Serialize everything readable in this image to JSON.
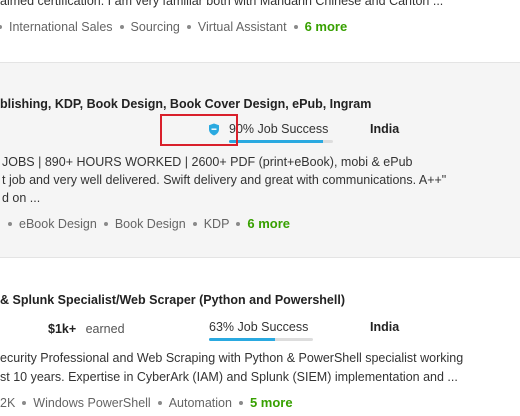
{
  "row1": {
    "cut_text": "aimed certification. I am very familiar both with Mandarin Chinese and Canton ...",
    "skills": [
      "International Sales",
      "Sourcing",
      "Virtual Assistant"
    ],
    "more": "6 more"
  },
  "row2": {
    "title": "blishing, KDP, Book Design, Book Cover Design, ePub, Ingram",
    "job_success": "90% Job Success",
    "job_success_value": 90,
    "country": "India",
    "desc_line1": "JOBS | 890+ HOURS WORKED | 2600+ PDF (print+eBook), mobi & ePub",
    "desc_line2": "t job and very well delivered. Swift delivery and great with communications. A++\"",
    "desc_line3": "d on ...",
    "skills": [
      "eBook Design",
      "Book Design",
      "KDP"
    ],
    "more": "6 more"
  },
  "row3": {
    "title": "& Splunk Specialist/Web Scraper (Python and Powershell)",
    "earned_value": "$1k+",
    "earned_label": "earned",
    "job_success": "63% Job Success",
    "job_success_value": 63,
    "country": "India",
    "desc_line1": "ecurity Professional and Web Scraping with Python & PowerShell specialist working",
    "desc_line2": "st 10 years. Expertise in CyberArk (IAM) and Splunk (SIEM) implementation and ...",
    "skills": [
      "2K",
      "Windows PowerShell",
      "Automation"
    ],
    "more": "5 more"
  },
  "colors": {
    "accent_green": "#37a000",
    "progress_blue": "#2aa9e0",
    "highlight_red": "#d9202b"
  }
}
